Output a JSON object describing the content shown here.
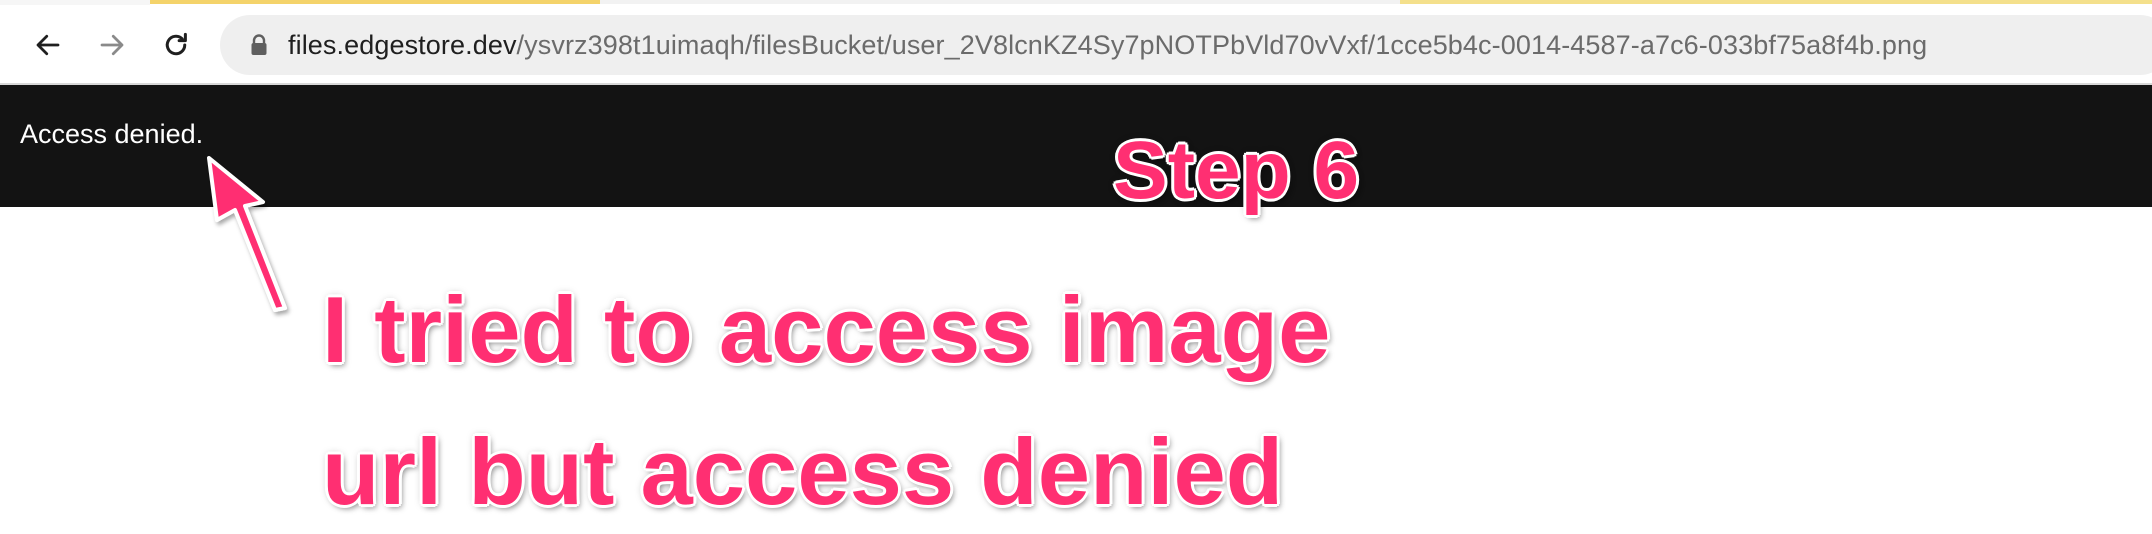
{
  "browser": {
    "url_host": "files.edgestore.dev",
    "url_path": "/ysvrz398t1uimaqh/filesBucket/user_2V8lcnKZ4Sy7pNOTPbVld70vVxf/1cce5b4c-0014-4587-a7c6-033bf75a8f4b.png",
    "icons": {
      "back": "arrow-left-icon",
      "forward": "arrow-right-icon",
      "reload": "reload-icon",
      "lock": "lock-icon"
    }
  },
  "page": {
    "message": "Access denied."
  },
  "annotations": {
    "step": "Step 6",
    "line1": "I tried to access image",
    "line2": "url but access denied",
    "color": "#ff2f72"
  }
}
